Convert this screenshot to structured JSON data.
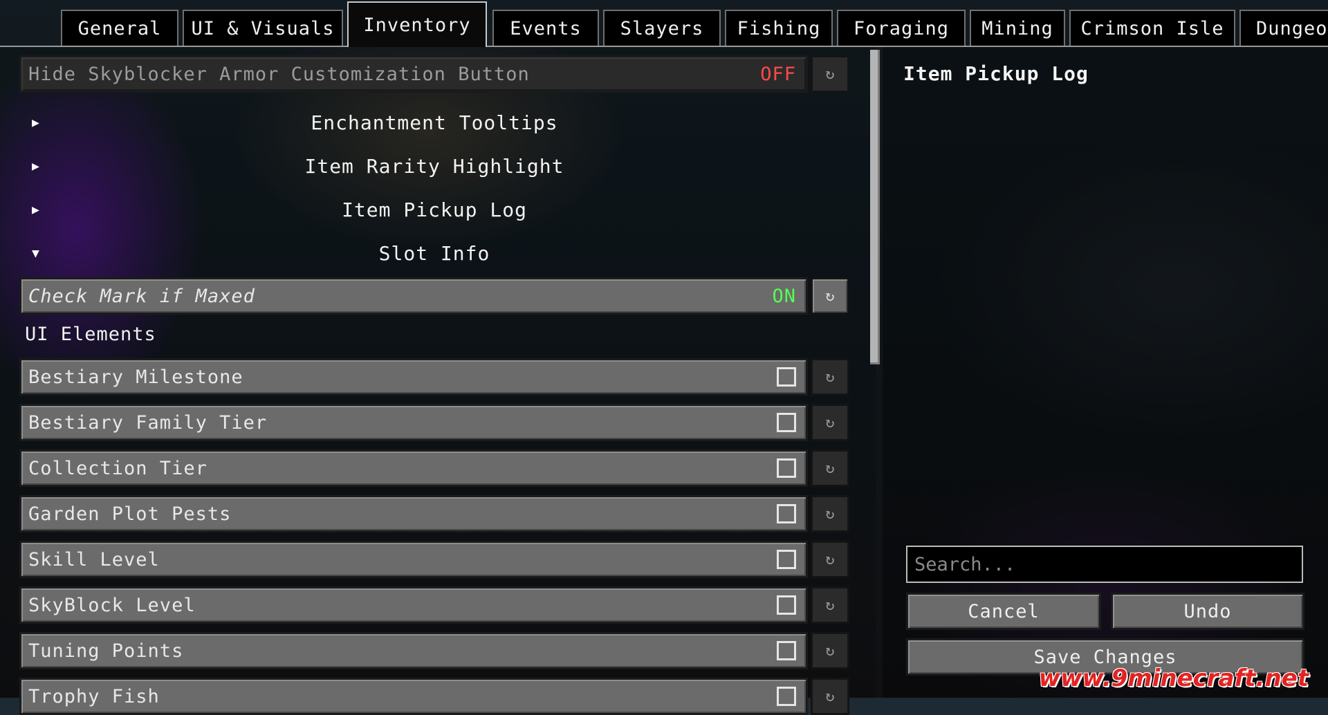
{
  "tabs": [
    "General",
    "UI & Visuals",
    "Inventory",
    "Events",
    "Slayers",
    "Fishing",
    "Foraging",
    "Mining",
    "Crimson Isle",
    "Dungeons"
  ],
  "active_tab": "Inventory",
  "options": {
    "hide_armor_button": {
      "label": "Hide Skyblocker Armor Customization Button",
      "state": "OFF"
    },
    "groups": [
      {
        "label": "Enchantment Tooltips",
        "arrow": "▶"
      },
      {
        "label": "Item Rarity Highlight",
        "arrow": "▶"
      },
      {
        "label": "Item Pickup Log",
        "arrow": "▶"
      },
      {
        "label": "Slot Info",
        "arrow": "▼"
      }
    ],
    "check_mark": {
      "label": "Check Mark if Maxed",
      "state": "ON"
    },
    "ui_elements_label": "UI Elements",
    "ui_elements": [
      "Bestiary Milestone",
      "Bestiary Family Tier",
      "Collection Tier",
      "Garden Plot Pests",
      "Skill Level",
      "SkyBlock Level",
      "Tuning Points",
      "Trophy Fish"
    ],
    "reset_glyph": "↻"
  },
  "description": {
    "title": "Item Pickup Log"
  },
  "search": {
    "placeholder": "Search..."
  },
  "buttons": {
    "cancel": "Cancel",
    "undo": "Undo",
    "save": "Save Changes"
  },
  "watermark": "www.9minecraft.net",
  "colors": {
    "off": "#ff4a4a",
    "on": "#55ff55"
  }
}
